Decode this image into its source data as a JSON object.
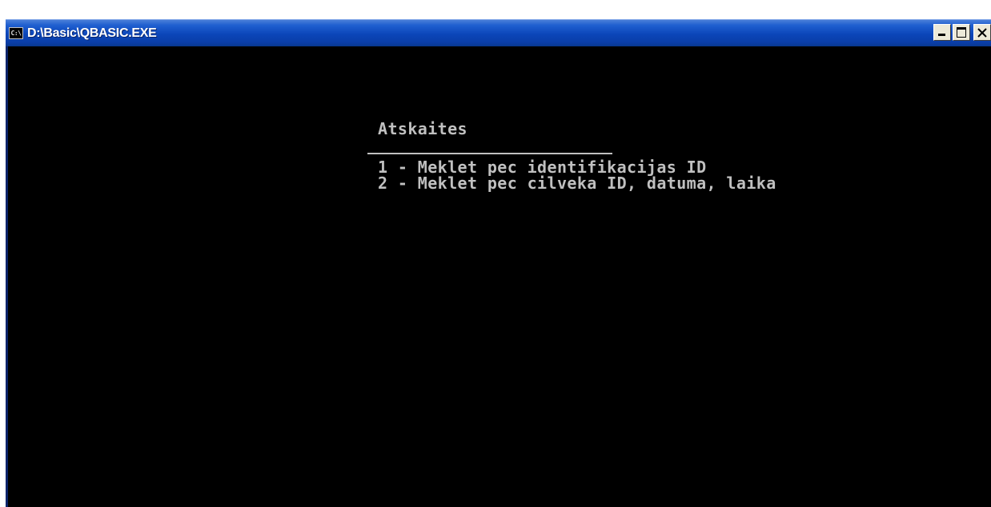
{
  "window": {
    "title": "D:\\Basic\\QBASIC.EXE",
    "icon_label": "C:\\"
  },
  "console": {
    "heading": "Atskaites",
    "menu": [
      "1 - Meklet pec identifikacijas ID",
      "2 - Meklet pec cilveka ID, datuma, laika"
    ]
  },
  "colors": {
    "titlebar": "#0b45b8",
    "console_bg": "#000000",
    "console_text": "#c0c0c0"
  }
}
